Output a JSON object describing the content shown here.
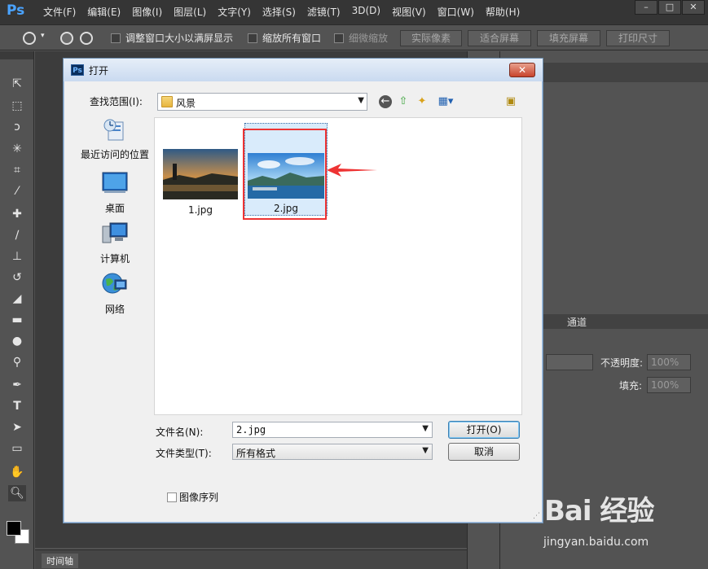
{
  "app": {
    "logo": "Ps",
    "menus": [
      "文件(F)",
      "编辑(E)",
      "图像(I)",
      "图层(L)",
      "文字(Y)",
      "选择(S)",
      "滤镜(T)",
      "3D(D)",
      "视图(V)",
      "窗口(W)",
      "帮助(H)"
    ],
    "window_controls": [
      "–",
      "□",
      "✕"
    ]
  },
  "options_bar": {
    "resize_windows": "调整窗口大小以满屏显示",
    "zoom_all": "缩放所有窗口",
    "scrubby_zoom": "细微缩放",
    "actual_pixels": "实际像素",
    "fit_screen": "适合屏幕",
    "fill_screen": "填充屏幕",
    "print_size": "打印尺寸"
  },
  "panels": {
    "channels_tab": "通道",
    "opacity_label": "不透明度:",
    "opacity_value": "100%",
    "fill_label": "填充:",
    "fill_value": "100%",
    "timeline_tab": "时间轴"
  },
  "dialog": {
    "title": "打开",
    "lookin_label": "查找范围(I):",
    "lookin_value": "风景",
    "places": [
      {
        "label": "最近访问的位置"
      },
      {
        "label": "桌面"
      },
      {
        "label": "计算机"
      },
      {
        "label": "网络"
      }
    ],
    "files": [
      {
        "name": "1.jpg"
      },
      {
        "name": "2.jpg"
      }
    ],
    "filename_label": "文件名(N):",
    "filename_value": "2.jpg",
    "filetype_label": "文件类型(T):",
    "filetype_value": "所有格式",
    "open_button": "打开(O)",
    "cancel_button": "取消",
    "image_sequence": "图像序列"
  },
  "watermark": {
    "logo": "Bai 经验",
    "site": "jingyan.baidu.com"
  }
}
